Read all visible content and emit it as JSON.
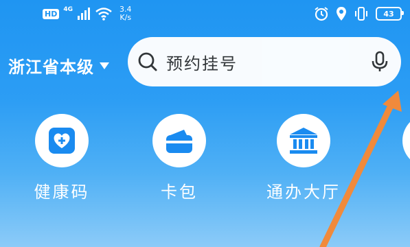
{
  "status_bar": {
    "hd_label": "HD",
    "network_label": "4G",
    "speed_value": "3.4",
    "speed_unit": "K/s",
    "battery_level": "43"
  },
  "header": {
    "region_label": "浙江省本级",
    "search_placeholder": "预约挂号"
  },
  "shortcuts": [
    {
      "label": "健康码",
      "icon": "health-code-icon"
    },
    {
      "label": "卡包",
      "icon": "card-wallet-icon"
    },
    {
      "label": "通办大厅",
      "icon": "service-hall-icon"
    },
    {
      "label": "",
      "icon": "partial-icon"
    }
  ],
  "colors": {
    "background_top": "#1f95f2",
    "icon_blue": "#1a8bf0",
    "arrow_orange": "#f08a3c"
  }
}
